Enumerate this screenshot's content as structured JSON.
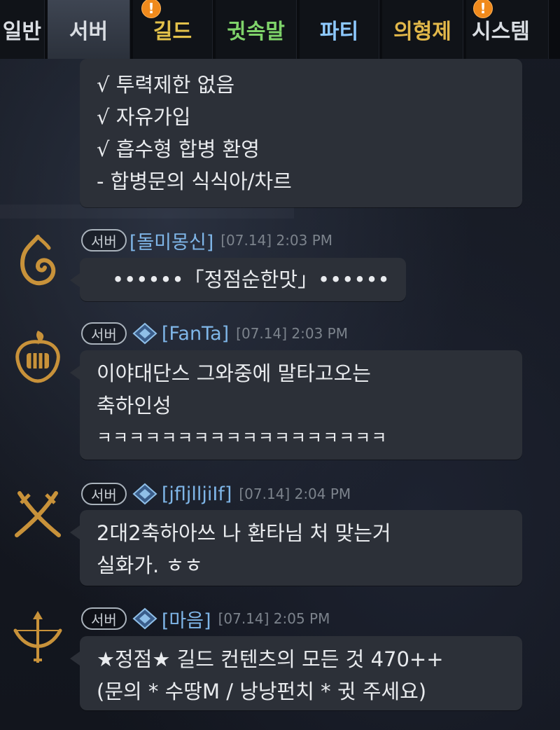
{
  "tabs": [
    {
      "label": "일반",
      "color": "#d9dde2",
      "badge": ""
    },
    {
      "label": "서버",
      "color": "#d9dde2",
      "badge": ""
    },
    {
      "label": "길드",
      "color": "#e2c14a",
      "badge": "!"
    },
    {
      "label": "귓속말",
      "color": "#7fd36a",
      "badge": ""
    },
    {
      "label": "파티",
      "color": "#8ec9ff",
      "badge": ""
    },
    {
      "label": "의형제",
      "color": "#e2b84a",
      "badge": ""
    },
    {
      "label": "시스템",
      "color": "#d9dde2",
      "badge": "!"
    }
  ],
  "messages": [
    {
      "lines": [
        "√ 투력제한 없음",
        "√ 자유가입",
        "√ 흡수형 합병 환영",
        " - 합병문의 식식아/차르"
      ]
    },
    {
      "server": "서버",
      "user": "[돌미몽신]",
      "time": "[07.14] 2:03 PM",
      "rank_icon": "",
      "avatar": "spiral-emblem-icon",
      "lines": [
        "••••••「정점순한맛」••••••"
      ]
    },
    {
      "server": "서버",
      "user": "[FanTa]",
      "time": "[07.14] 2:03 PM",
      "rank_icon": "diamond-rank-icon",
      "avatar": "fist-flame-emblem-icon",
      "lines": [
        "이야대단스 그와중에 말타고오는",
        "축하인성",
        "ㅋㅋㅋㅋㅋㅋㅋㅋㅋㅋㅋㅋㅋㅋㅋㅋㅋㅋ"
      ]
    },
    {
      "server": "서버",
      "user": "[jfljlljiIf]",
      "time": "[07.14] 2:04 PM",
      "rank_icon": "diamond-rank-icon",
      "avatar": "crossed-swords-emblem-icon",
      "lines": [
        "2대2축하아쓰  나 환타님 처 맞는거",
        "실화가. ㅎㅎ"
      ]
    },
    {
      "server": "서버",
      "user": "[마음]",
      "time": "[07.14] 2:05 PM",
      "rank_icon": "diamond-rank-icon",
      "avatar": "bow-arrow-emblem-icon",
      "lines": [
        "★정점★  길드 컨텐츠의 모든 것 470++",
        "(문의 * 수땅M / 낭낭펀치 * 귓 주세요)"
      ]
    }
  ],
  "colors": {
    "accent": "#f08a1c",
    "username": "#7fb6e8",
    "bubble": "#2c3038",
    "emblem": "#c8923a"
  }
}
